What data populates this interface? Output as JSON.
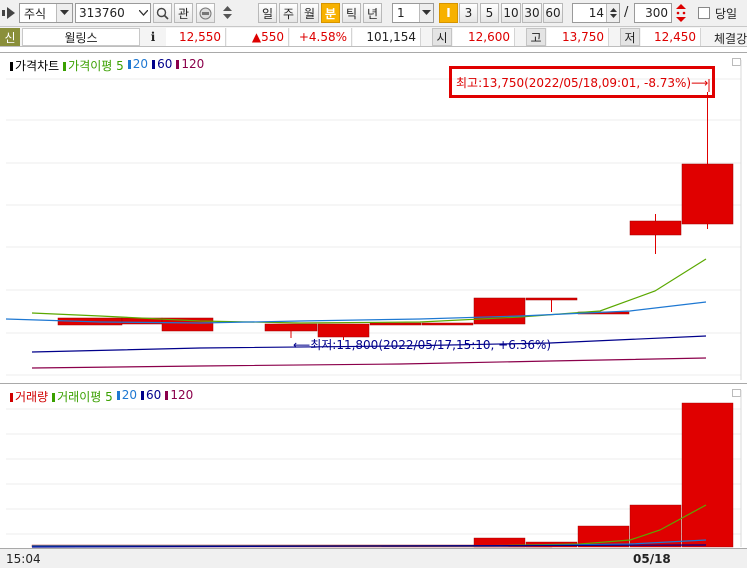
{
  "toolbar": {
    "market": "주식",
    "code": "313760",
    "interest_btn": "관",
    "periods": [
      "일",
      "주",
      "월",
      "분",
      "틱",
      "년"
    ],
    "active_period": "분",
    "interval": "1",
    "interval_marker": "I",
    "quick_intervals": [
      "3",
      "5",
      "10",
      "30",
      "60"
    ],
    "count": "14",
    "separator": "/",
    "total": "300",
    "same_day_label": "당일"
  },
  "infobar": {
    "credit_badge": "신",
    "name": "윌링스",
    "info_icon": "i",
    "price": "12,550",
    "change": "▲550",
    "change_pct": "+4.58%",
    "volume": "101,154",
    "open_label": "시",
    "open": "12,600",
    "high_label": "고",
    "high": "13,750",
    "low_label": "저",
    "low": "12,450",
    "strength_label": "체결강"
  },
  "price_panel": {
    "legend": [
      {
        "label": "가격차트",
        "color": "#000000"
      },
      {
        "label": "가격이평 5",
        "color": "#3aa000"
      },
      {
        "label": "20",
        "color": "#1e78d2"
      },
      {
        "label": "60",
        "color": "#00008b"
      },
      {
        "label": "120",
        "color": "#8b004b"
      }
    ],
    "high_annotation": "최고:13,750(2022/05/18,09:01, -8.73%)⟶",
    "low_annotation": "⟵최저:11,800(2022/05/17,15:10, +6.36%)"
  },
  "volume_panel": {
    "legend": [
      {
        "label": "거래량",
        "color": "#d00000"
      },
      {
        "label": "거래이평 5",
        "color": "#3aa000"
      },
      {
        "label": "20",
        "color": "#1e78d2"
      },
      {
        "label": "60",
        "color": "#00008b"
      },
      {
        "label": "120",
        "color": "#8b004b"
      }
    ]
  },
  "axis": {
    "start_time": "15:04",
    "date_label": "05/18"
  },
  "colors": {
    "up": "#e00000",
    "ma5": "#5aa800",
    "ma20": "#1e78d2",
    "ma60": "#00008b",
    "ma120": "#8b004b"
  }
}
